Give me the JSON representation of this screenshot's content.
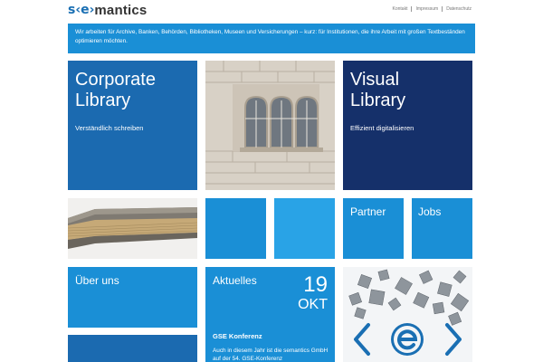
{
  "header": {
    "logo_mark": "s‹e›",
    "logo_text": "mantics",
    "links": [
      "Kontakt",
      "Impressum",
      "Datenschutz"
    ]
  },
  "banner": {
    "text": "Wir arbeiten für Archive, Banken, Behörden, Bibliotheken, Museen und Versicherungen – kurz: für Institutionen, die ihre Arbeit mit großen Textbeständen optimieren möchten."
  },
  "tiles": {
    "corporate": {
      "title_line1": "Corporate",
      "title_line2": "Library",
      "subtitle": "Verständlich schreiben"
    },
    "visual": {
      "title_line1": "Visual",
      "title_line2": "Library",
      "subtitle": "Effizient digitalisieren"
    },
    "partner": {
      "title": "Partner"
    },
    "jobs": {
      "title": "Jobs"
    },
    "about": {
      "title": "Über uns"
    },
    "news": {
      "title": "Aktuelles",
      "day": "19",
      "month": "OKT",
      "headline": "GSE Konferenz",
      "body": "Auch in diesem Jahr ist die semantics GmbH auf der 54. GSE-Konferenz"
    }
  },
  "colors": {
    "light_blue": "#1a8fd6",
    "mid_blue": "#1b6ab0",
    "dark_blue": "#15306a"
  }
}
